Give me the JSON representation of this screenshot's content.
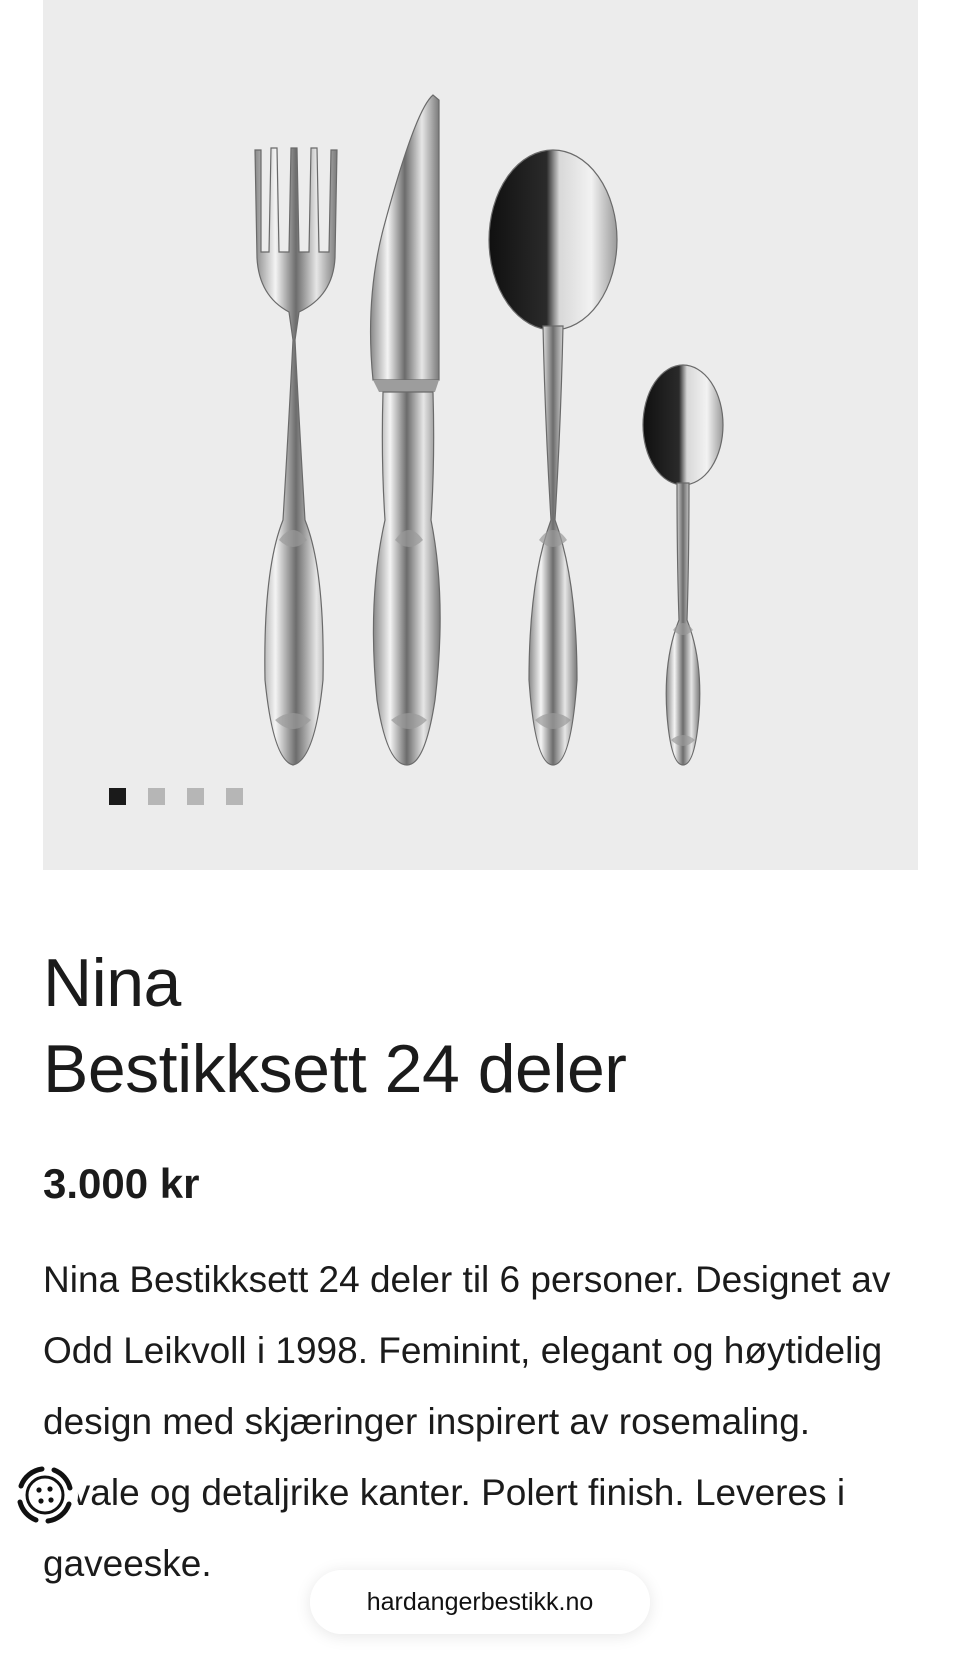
{
  "product": {
    "brand_line": "Nina",
    "name_line": "Bestikksett 24 deler",
    "price": "3.000 kr",
    "description": "Nina Bestikksett 24 deler til 6 personer. Designet av Odd Leikvoll i 1998. Feminint, elegant og høytidelig design med skjæringer inspirert av rosemaling. Ovale og detaljrike kanter. Polert finish. Leveres i gaveeske."
  },
  "gallery": {
    "image_count": 4,
    "active_index": 0,
    "image_subject": "fork, knife, spoon, teaspoon",
    "background": "#ececec"
  },
  "cookie_button": {
    "icon": "cookie-icon"
  },
  "address_bar": {
    "url": "hardangerbestikk.no"
  },
  "colors": {
    "text": "#1b1b1b",
    "dot_active": "#1a1a1a",
    "dot_inactive": "#b6b6b6"
  }
}
